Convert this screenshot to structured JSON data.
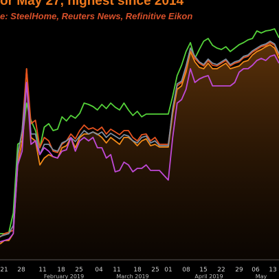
{
  "header": {
    "title": "or May 27, highest since 2014",
    "source": "e:  SteelHome, Reuters News, Refinitive Eikon"
  },
  "chart_data": {
    "type": "line",
    "title": "or May 27, highest since 2014",
    "source_note": "e:  SteelHome, Reuters News, Refinitive Eikon",
    "xlabel": "",
    "ylabel": "",
    "grid": false,
    "legend": "none",
    "x_ticks": [
      "21",
      "28",
      "11",
      "18",
      "25",
      "04",
      "11",
      "18",
      "25",
      "01",
      "08",
      "15",
      "22",
      "29",
      "06",
      "13"
    ],
    "month_labels": [
      "February 2019",
      "March 2019",
      "April 2019",
      "May"
    ],
    "series": [
      {
        "color": "#55d43a",
        "values": [
          340,
          340,
          338,
          310,
          210,
          205,
          150,
          175,
          190,
          215,
          185,
          180,
          190,
          188,
          170,
          176,
          168,
          172,
          165,
          150,
          152,
          155,
          160,
          152,
          158,
          150,
          156,
          160,
          150,
          160,
          168,
          162,
          170,
          166,
          166,
          166,
          166,
          166,
          166,
          140,
          110,
          95,
          75,
          62,
          85,
          72,
          60,
          56,
          66,
          70,
          72,
          68,
          75,
          70,
          65,
          62,
          58,
          56,
          45,
          48,
          45,
          44,
          42,
          55
        ]
      },
      {
        "color": "#f28a18",
        "values": [
          355,
          350,
          350,
          340,
          240,
          205,
          100,
          200,
          205,
          240,
          230,
          225,
          228,
          230,
          215,
          212,
          200,
          215,
          200,
          195,
          195,
          192,
          195,
          200,
          208,
          200,
          205,
          210,
          200,
          200,
          205,
          212,
          205,
          202,
          212,
          210,
          214,
          214,
          214,
          165,
          130,
          125,
          105,
          75,
          90,
          98,
          100,
          92,
          100,
          100,
          96,
          92,
          100,
          98,
          96,
          90,
          88,
          80,
          75,
          72,
          68,
          65,
          70,
          85
        ]
      },
      {
        "color": "#e8531f",
        "values": [
          345,
          340,
          338,
          335,
          230,
          190,
          100,
          180,
          175,
          215,
          200,
          205,
          220,
          222,
          210,
          205,
          195,
          202,
          190,
          182,
          188,
          186,
          190,
          185,
          195,
          188,
          192,
          196,
          190,
          190,
          200,
          205,
          196,
          195,
          205,
          200,
          210,
          210,
          210,
          160,
          125,
          120,
          100,
          70,
          85,
          92,
          96,
          88,
          95,
          96,
          92,
          88,
          96,
          92,
          90,
          84,
          82,
          76,
          72,
          68,
          66,
          62,
          66,
          80
        ]
      },
      {
        "color": "#7f8fa0",
        "values": [
          344,
          342,
          340,
          328,
          225,
          190,
          120,
          195,
          195,
          225,
          210,
          210,
          218,
          220,
          208,
          205,
          200,
          206,
          198,
          190,
          195,
          192,
          196,
          192,
          200,
          194,
          198,
          202,
          196,
          198,
          205,
          208,
          200,
          198,
          208,
          205,
          212,
          212,
          212,
          158,
          122,
          118,
          96,
          70,
          82,
          90,
          94,
          86,
          92,
          94,
          90,
          86,
          94,
          90,
          88,
          82,
          80,
          74,
          70,
          66,
          64,
          60,
          64,
          78
        ]
      },
      {
        "color": "#c04ad8",
        "values": [
          352,
          350,
          348,
          340,
          240,
          220,
          120,
          210,
          205,
          225,
          215,
          220,
          228,
          230,
          220,
          218,
          200,
          220,
          205,
          200,
          205,
          200,
          215,
          215,
          230,
          225,
          250,
          248,
          236,
          240,
          250,
          245,
          245,
          240,
          248,
          248,
          248,
          255,
          262,
          200,
          150,
          145,
          130,
          100,
          120,
          115,
          112,
          110,
          125,
          125,
          125,
          125,
          125,
          120,
          105,
          100,
          100,
          95,
          88,
          85,
          88,
          82,
          80,
          92
        ]
      }
    ]
  }
}
